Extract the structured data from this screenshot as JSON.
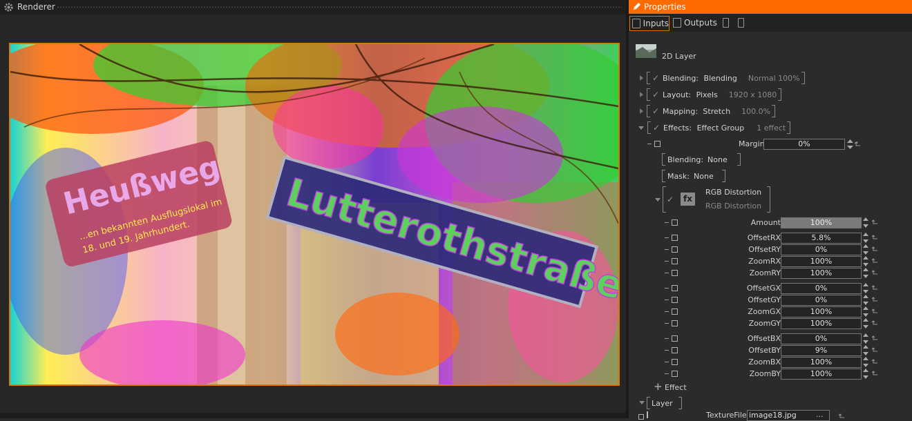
{
  "renderer": {
    "title": "Renderer",
    "image_text": {
      "street_sign": "Lutterothstraße",
      "sign_left": "Heußweg",
      "plaque_line1": "...en bekannten Ausflugslokal im",
      "plaque_line2": "18. und 19. Jahrhundert."
    }
  },
  "properties": {
    "title": "Properties",
    "tabs": {
      "inputs": "Inputs",
      "outputs": "Outputs"
    },
    "layer_name": "2D Layer",
    "groups": [
      {
        "label": "Blending:",
        "value": "Blending",
        "extra": "Normal 100%"
      },
      {
        "label": "Layout:",
        "value": "Pixels",
        "extra": "1920 x 1080"
      },
      {
        "label": "Mapping:",
        "value": "Stretch",
        "extra": "100.0%"
      },
      {
        "label": "Effects:",
        "value": "Effect Group",
        "extra": "1 effect"
      }
    ],
    "margin": {
      "label": "Margin",
      "value": "0%"
    },
    "sub_blending": {
      "label": "Blending:",
      "value": "None"
    },
    "mask": {
      "label": "Mask:",
      "value": "None"
    },
    "effect": {
      "badge": "fx",
      "name": "RGB Distortion",
      "sub": "RGB Distortion"
    },
    "params": [
      {
        "name": "Amount",
        "value": "100%",
        "filled": true,
        "fill": 1.0
      },
      {
        "name": "OffsetRX",
        "value": "5.8%"
      },
      {
        "name": "OffsetRY",
        "value": "0%"
      },
      {
        "name": "ZoomRX",
        "value": "100%"
      },
      {
        "name": "ZoomRY",
        "value": "100%"
      },
      {
        "name": "OffsetGX",
        "value": "0%"
      },
      {
        "name": "OffsetGY",
        "value": "0%"
      },
      {
        "name": "ZoomGX",
        "value": "100%"
      },
      {
        "name": "ZoomGY",
        "value": "100%"
      },
      {
        "name": "OffsetBX",
        "value": "0%"
      },
      {
        "name": "OffsetBY",
        "value": "9%"
      },
      {
        "name": "ZoomBX",
        "value": "100%"
      },
      {
        "name": "ZoomBY",
        "value": "100%"
      }
    ],
    "add_effect": "Effect",
    "layer_section": "Layer",
    "texture": {
      "label": "TextureFile",
      "value": "image18.jpg",
      "browse": "..."
    }
  },
  "colors": {
    "accent": "#ff6a00",
    "frame": "#e07800"
  }
}
